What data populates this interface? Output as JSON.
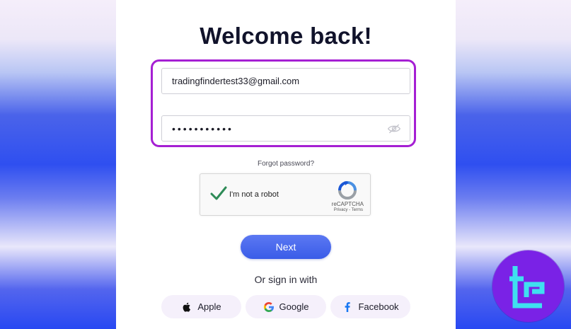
{
  "login": {
    "title": "Welcome back!",
    "email_value": "tradingfindertest33@gmail.com",
    "password_value": "•••••••••••",
    "forgot_link": "Forgot password?",
    "next_label": "Next",
    "or_label": "Or sign in with"
  },
  "captcha": {
    "label": "I'm not a robot",
    "brand": "reCAPTCHA",
    "links": "Privacy - Terms"
  },
  "social": {
    "apple": "Apple",
    "google": "Google",
    "facebook": "Facebook"
  },
  "colors": {
    "highlight": "#a51fd3",
    "button": "#4a68ee",
    "brand_badge": "#7a22e6",
    "brand_glyph": "#3fe0f0"
  },
  "icons": {
    "password_toggle": "eye-slash-icon",
    "captcha_check": "checkmark-icon",
    "captcha_logo": "recaptcha-icon",
    "apple": "apple-icon",
    "google": "google-icon",
    "facebook": "facebook-icon",
    "brand": "tradingfinder-logo-icon"
  }
}
